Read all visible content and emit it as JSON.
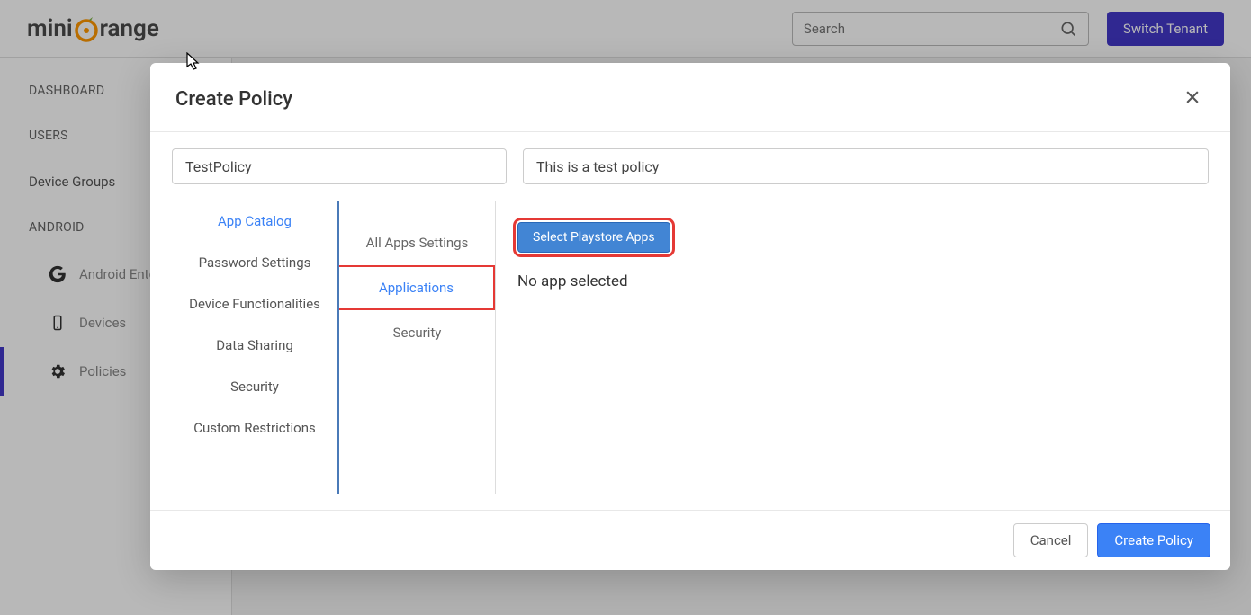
{
  "header": {
    "logo_prefix": "mini",
    "logo_suffix": "range",
    "search_placeholder": "Search",
    "switch_tenant": "Switch Tenant"
  },
  "sidebar": {
    "dashboard": "DASHBOARD",
    "users": "USERS",
    "device_groups": "Device Groups",
    "android": "ANDROID",
    "android_enterprise": "Android Ente",
    "devices": "Devices",
    "policies": "Policies"
  },
  "modal": {
    "title": "Create Policy",
    "name_value": "TestPolicy",
    "desc_value": "This is a test policy",
    "categories": {
      "app_catalog": "App Catalog",
      "password_settings": "Password Settings",
      "device_functionalities": "Device Functionalities",
      "data_sharing": "Data Sharing",
      "security": "Security",
      "custom_restrictions": "Custom Restrictions"
    },
    "subcategories": {
      "all_apps_settings": "All Apps Settings",
      "applications": "Applications",
      "security": "Security"
    },
    "select_playstore": "Select Playstore Apps",
    "no_app": "No app selected",
    "cancel": "Cancel",
    "create": "Create Policy"
  }
}
